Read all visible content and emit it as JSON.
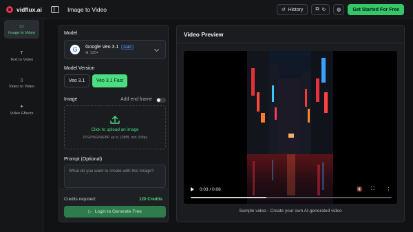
{
  "app": {
    "brand_name": "vidflux.ai",
    "page_title": "Image to Video",
    "accent_color": "#4ade80"
  },
  "topbar": {
    "history_label": "History",
    "cta_label": "Get Started For Free",
    "icons": [
      "sidebar-toggle-icon",
      "history-icon",
      "link-icon",
      "refresh-icon",
      "globe-icon"
    ]
  },
  "sidebar": {
    "items": [
      {
        "label": "Image to Video",
        "icon": "video-icon",
        "active": true
      },
      {
        "label": "Text to Video",
        "icon": "text-icon",
        "active": false
      },
      {
        "label": "Video to Video",
        "icon": "file-icon",
        "active": false
      },
      {
        "label": "Video Effects",
        "icon": "sparkle-icon",
        "active": false
      }
    ]
  },
  "form": {
    "model_label": "Model",
    "model_name": "Google Veo 3.1",
    "model_badge": "Audio",
    "model_sub": "120+",
    "version_label": "Model Version",
    "versions": [
      {
        "label": "Veo 3.1",
        "selected": false
      },
      {
        "label": "Veo 3.1 Fast",
        "selected": true
      }
    ],
    "image_label": "Image",
    "add_end_frame_label": "Add end frame",
    "upload_text": "Click to upload an image",
    "upload_sub": "JPG/PNG/WEBP up to 10MB, min 300px",
    "prompt_label": "Prompt (Optional)",
    "prompt_placeholder": "What do you want to create with this image?",
    "credits_label": "Credits required:",
    "credits_value": "120 Credits",
    "generate_label": "Login to Generate Free"
  },
  "preview": {
    "header": "Video Preview",
    "time": "0:03 / 0:08",
    "progress": 0.375,
    "caption": "Sample video - Create your own AI-generated video"
  }
}
